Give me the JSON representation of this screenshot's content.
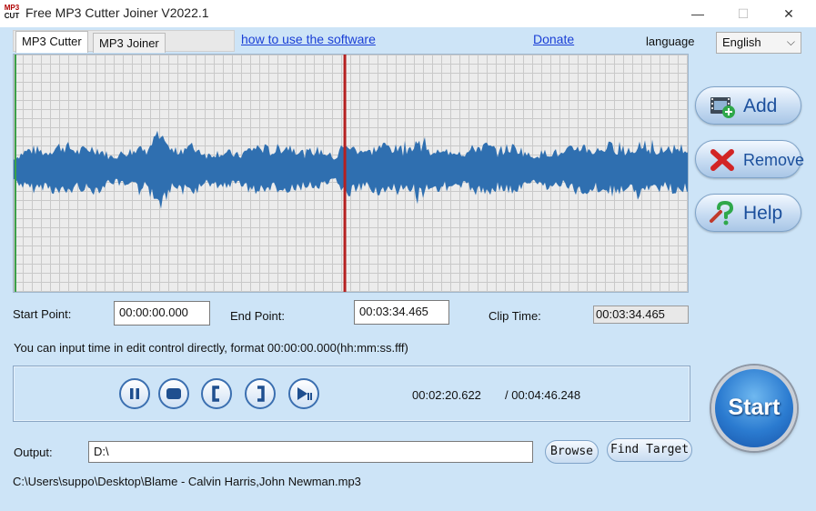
{
  "app": {
    "title": "Free MP3 Cutter Joiner V2022.1",
    "logo_top": "MP3",
    "logo_bottom": "CUT"
  },
  "window_controls": {
    "minimize": "—",
    "maximize": "☐",
    "close": "✕"
  },
  "tabs": [
    {
      "label": "MP3 Cutter",
      "active": true
    },
    {
      "label": "MP3 Joiner",
      "active": false
    }
  ],
  "links": {
    "howto": "how to use the software",
    "donate": "Donate"
  },
  "language": {
    "label": "language",
    "selected": "English"
  },
  "side_buttons": {
    "add": "Add",
    "remove": "Remove",
    "help": "Help"
  },
  "times": {
    "start_label": "Start Point:",
    "start_value": "00:00:00.000",
    "end_label": "End Point:",
    "end_value": "00:03:34.465",
    "clip_label": "Clip Time:",
    "clip_value": "00:03:34.465",
    "hint": "You can input time in edit control directly, format 00:00:00.000(hh:mm:ss.fff)"
  },
  "player": {
    "current": "00:02:20.622",
    "total": "/ 00:04:46.248",
    "playhead_fraction": 0.49
  },
  "start_button": "Start",
  "output": {
    "label": "Output:",
    "value": "D:\\",
    "browse": "Browse",
    "find_target": "Find Target"
  },
  "current_file": "C:\\Users\\suppo\\Desktop\\Blame - Calvin Harris,John Newman.mp3",
  "colors": {
    "background": "#cde4f7",
    "wave": "#2f6fb0",
    "playhead": "#b52020",
    "start_marker": "#3aa04a",
    "link": "#1a3fd6"
  }
}
